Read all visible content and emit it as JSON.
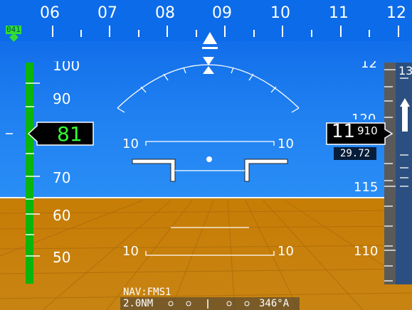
{
  "heading_tape": {
    "labels": [
      "06",
      "07",
      "08",
      "09",
      "10",
      "11",
      "12"
    ],
    "bug_value": "041"
  },
  "airspeed_tape": {
    "labels": [
      "90",
      "70",
      "60",
      "50"
    ],
    "partial_top": "100",
    "current": "81"
  },
  "pitch_ladder": {
    "left_label": "10",
    "right_label": "10",
    "lower_left_label": "10",
    "lower_right_label": "10"
  },
  "altitude_tape": {
    "labels": [
      "115",
      "110"
    ],
    "partial_top": "12",
    "partial_mid": "120",
    "current_major": "11",
    "current_minor": "910",
    "baro": "29.72"
  },
  "vsi": {
    "top_label": "13"
  },
  "nav_status": {
    "source": "NAV:FMS1",
    "distance": "2.0NM",
    "bearing": "346°A"
  },
  "colors": {
    "sky": "#1f7ff0",
    "ground": "#c77d06",
    "speed_green": "#09b40c",
    "heading_bug": "#33dd33",
    "airspeed_text": "#33ff33"
  }
}
